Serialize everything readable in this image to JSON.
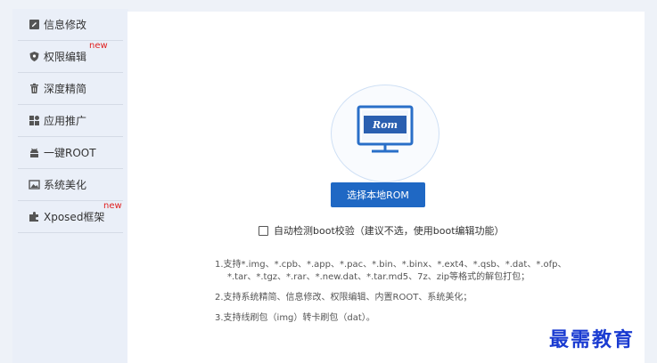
{
  "sidebar": {
    "items": [
      {
        "label": "信息修改",
        "icon": "edit-icon",
        "new": ""
      },
      {
        "label": "权限编辑",
        "icon": "shield-icon",
        "new": "new"
      },
      {
        "label": "深度精简",
        "icon": "trash-icon",
        "new": ""
      },
      {
        "label": "应用推广",
        "icon": "apps-icon",
        "new": ""
      },
      {
        "label": "一键ROOT",
        "icon": "android-icon",
        "new": ""
      },
      {
        "label": "系统美化",
        "icon": "image-icon",
        "new": ""
      },
      {
        "label": "Xposed框架",
        "icon": "puzzle-icon",
        "new": "new"
      }
    ]
  },
  "main": {
    "rom_label": "Rom",
    "choose_button": "选择本地ROM",
    "checkbox_label": "自动检测boot校验（建议不选，使用boot编辑功能）",
    "notes": {
      "line1a": "1.支持*.img、*.cpb、*.app、*.pac、*.bin、*.binx、*.ext4、*.qsb、*.dat、*.ofp、",
      "line1b": "*.tar、*.tgz、*.rar、*.new.dat、*.tar.md5、7z、zip等格式的解包打包；",
      "line2": "2.支持系统精简、信息修改、权限编辑、内置ROOT、系统美化；",
      "line3": "3.支持线刷包（img）转卡刷包（dat）。"
    }
  },
  "watermark": "最需教育",
  "colors": {
    "accent": "#1f68c4",
    "new_tag": "#e02020",
    "watermark": "#1a3bd1"
  }
}
